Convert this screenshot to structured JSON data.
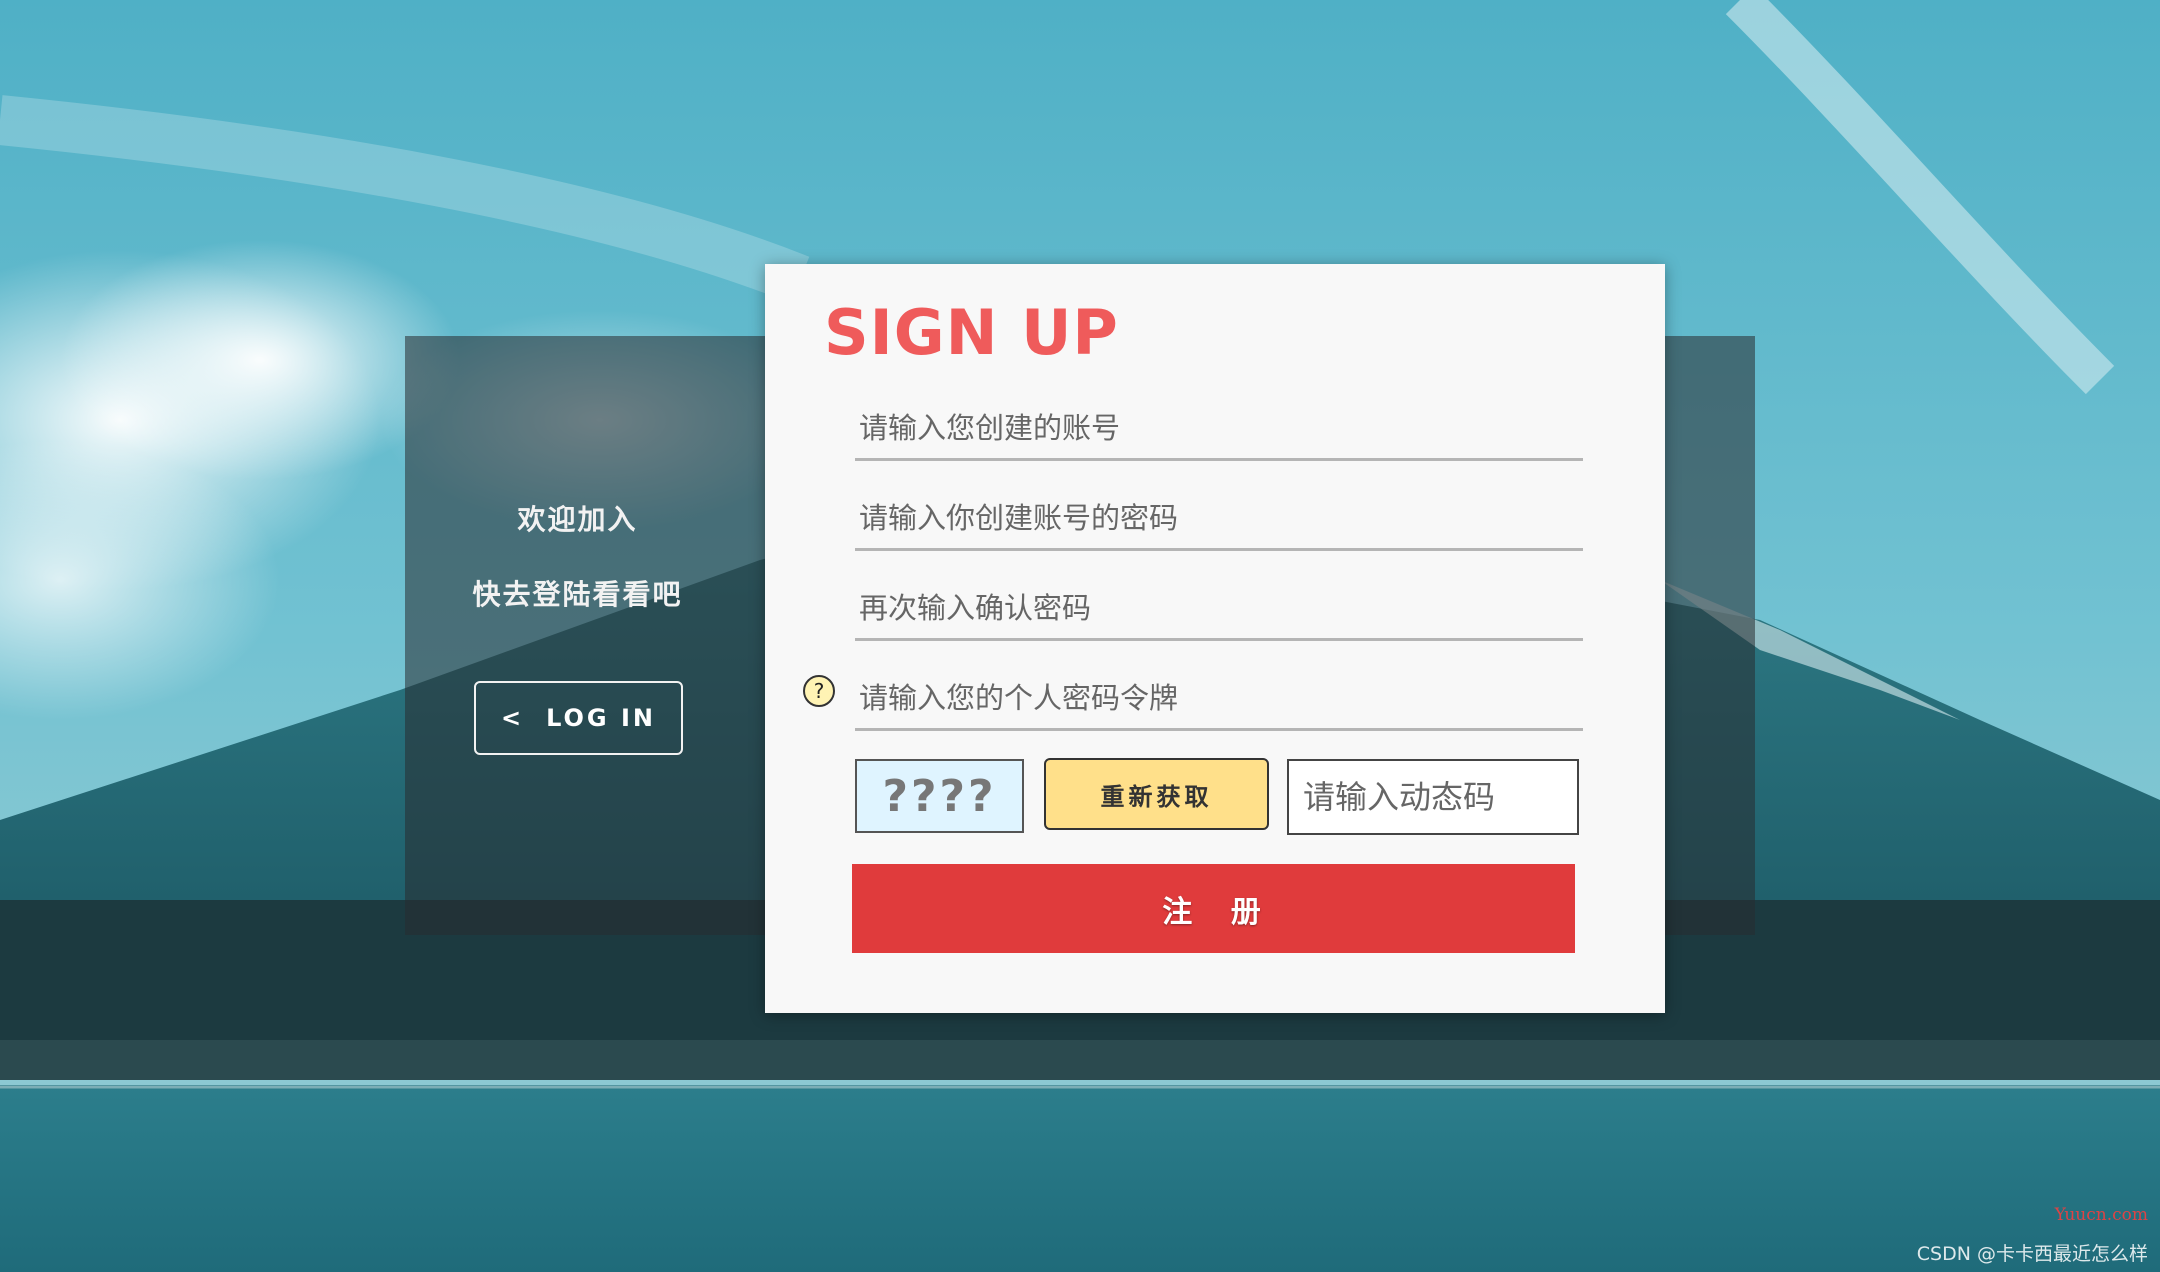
{
  "left_panel": {
    "welcome_line_1": "欢迎加入",
    "welcome_line_2": "快去登陆看看吧",
    "login_button": {
      "chevron": "<",
      "label": "LOG IN"
    }
  },
  "signup_form": {
    "title": "SIGN UP",
    "account_placeholder": "请输入您创建的账号",
    "password_placeholder": "请输入你创建账号的密码",
    "confirm_placeholder": "再次输入确认密码",
    "token_placeholder": "请输入您的个人密码令牌",
    "help_icon_glyph": "?",
    "captcha_text": "????",
    "refresh_button": "重新获取",
    "dynamic_code_placeholder": "请输入动态码",
    "register_button": "注 册"
  },
  "watermarks": {
    "site": "Yuucn.com",
    "author": "CSDN @卡卡西最近怎么样"
  },
  "colors": {
    "title": "#ef5b5b",
    "register_button": "#e03b3c",
    "refresh_button": "#ffe08a",
    "captcha_bg": "#dff4ff"
  },
  "icons": {
    "help": "question-circle-icon",
    "login_chevron": "chevron-left-icon"
  }
}
